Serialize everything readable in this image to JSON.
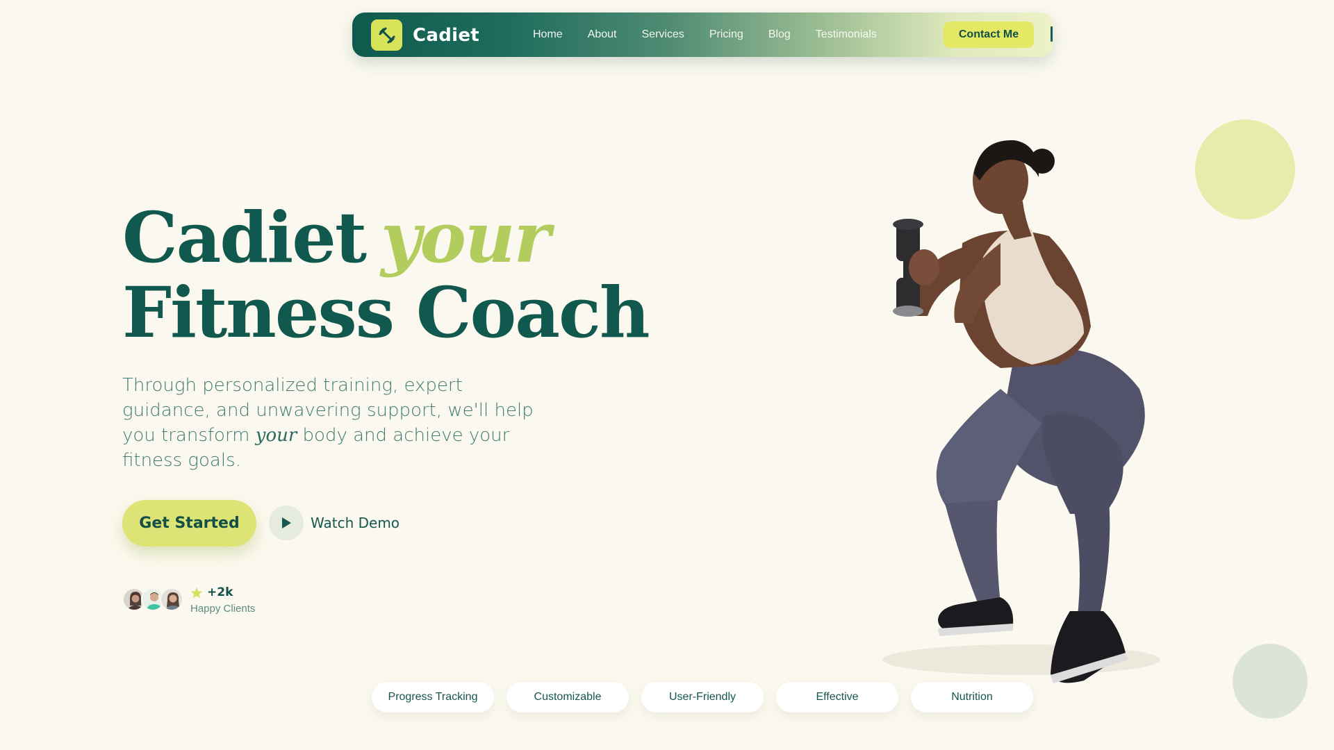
{
  "brand": {
    "name": "Cadiet",
    "logo_icon": "dumbbell-icon"
  },
  "nav": {
    "links": [
      "Home",
      "About",
      "Services",
      "Pricing",
      "Blog",
      "Testimonials"
    ],
    "contact_label": "Contact Me"
  },
  "hero": {
    "title_line1_word": "Cadiet",
    "title_accent": "your",
    "title_line2": "Fitness Coach",
    "desc_part1": "Through personalized training, expert guidance, and unwavering support, we'll help you transform ",
    "desc_italic": "your",
    "desc_part2": " body and achieve your fitness goals.",
    "cta_label": "Get Started",
    "demo_label": "Watch Demo"
  },
  "clients": {
    "count": "+2k",
    "label": "Happy Clients",
    "star_icon": "star-icon"
  },
  "tags": [
    "Progress Tracking",
    "Customizable",
    "User-Friendly",
    "Effective",
    "Nutrition"
  ],
  "colors": {
    "background": "#fbf9ef",
    "primary": "#11594e",
    "accent": "#dde475",
    "accent_text": "#b2cc5d"
  }
}
